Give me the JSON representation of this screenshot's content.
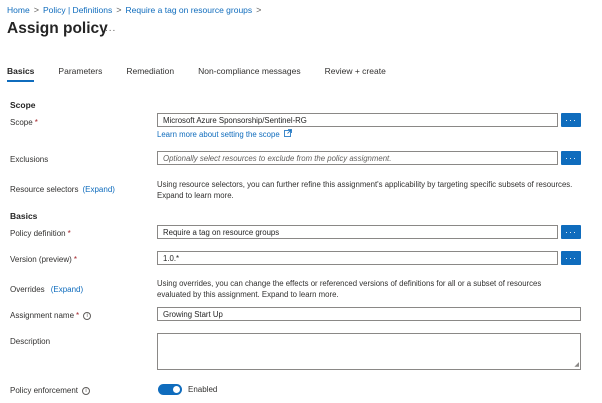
{
  "breadcrumb": {
    "items": [
      "Home",
      "Policy | Definitions",
      "Require a tag on resource groups"
    ],
    "separator": ">"
  },
  "page": {
    "title": "Assign policy",
    "more": "..."
  },
  "tabs": [
    {
      "label": "Basics",
      "active": true
    },
    {
      "label": "Parameters",
      "active": false
    },
    {
      "label": "Remediation",
      "active": false
    },
    {
      "label": "Non-compliance messages",
      "active": false
    },
    {
      "label": "Review + create",
      "active": false
    }
  ],
  "scope_section": {
    "heading": "Scope",
    "scope_label": "Scope",
    "scope_value": "Microsoft Azure Sponsorship/Sentinel-RG",
    "scope_link": "Learn more about setting the scope",
    "exclusions_label": "Exclusions",
    "exclusions_placeholder": "Optionally select resources to exclude from the policy assignment.",
    "resource_selectors_label": "Resource selectors",
    "resource_selectors_expand": "(Expand)",
    "resource_selectors_info": "Using resource selectors, you can further refine this assignment's applicability by targeting specific subsets of resources. Expand to learn more."
  },
  "basics_section": {
    "heading": "Basics",
    "policy_definition_label": "Policy definition",
    "policy_definition_value": "Require a tag on resource groups",
    "version_label": "Version (preview)",
    "version_value": "1.0.*",
    "overrides_label": "Overrides",
    "overrides_expand": "(Expand)",
    "overrides_info": "Using overrides, you can change the effects or referenced versions of definitions for all or a subset of resources evaluated by this assignment. Expand to learn more.",
    "assignment_name_label": "Assignment name",
    "assignment_name_value": "Growing Start Up",
    "description_label": "Description",
    "description_value": "",
    "policy_enforcement_label": "Policy enforcement",
    "policy_enforcement_value": "Enabled"
  },
  "common": {
    "required_mark": "*",
    "ellipsis_button": "···",
    "info_glyph": "i"
  },
  "colors": {
    "accent": "#0f6cbd",
    "required": "#a4262c"
  }
}
